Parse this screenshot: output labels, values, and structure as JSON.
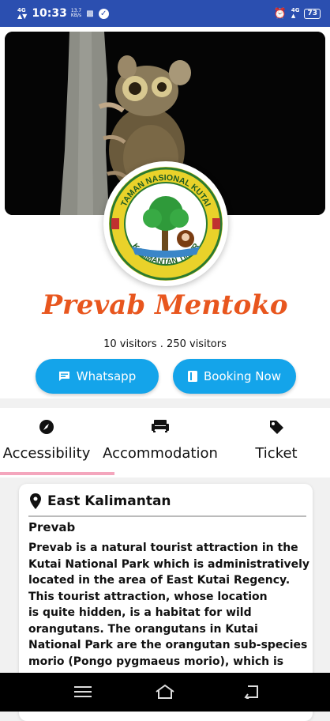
{
  "status_bar": {
    "network": "4G",
    "network2": "4G",
    "time": "10:33",
    "speed_value": "13.7",
    "speed_unit": "KB/s",
    "battery": "73"
  },
  "place": {
    "name": "Prevab Mentoko",
    "visitors_text": "10  visitors . 250  visitors"
  },
  "logo": {
    "top_text": "TAMAN NASIONAL KUTAI",
    "bottom_text": "KALIMANTAN TIMUR"
  },
  "buttons": {
    "whatsapp": "Whatsapp",
    "booking": "Booking Now"
  },
  "tabs": [
    {
      "label": "Accessibility",
      "icon": "compass-icon"
    },
    {
      "label": "Accommodation",
      "icon": "sofa-icon"
    },
    {
      "label": "Ticket",
      "icon": "tag-icon"
    }
  ],
  "content": {
    "location": "East Kalimantan",
    "heading": "Prevab",
    "lines": [
      "Prevab is a natural tourist attraction in the",
      "Kutai National Park which is administratively",
      "located in the area of East Kutai Regency.",
      "This tourist attraction, whose location",
      "is quite hidden, is a habitat for wild",
      "orangutans. The orangutans in Kutai",
      "National Park are the orangutan sub-species",
      "morio (Pongo pygmaeus morio), which is"
    ]
  },
  "colors": {
    "accent_blue": "#14a4ea",
    "title_orange": "#e8561e",
    "tab_indicator": "#f4a6bd",
    "status_bar": "#2b4fb0"
  }
}
